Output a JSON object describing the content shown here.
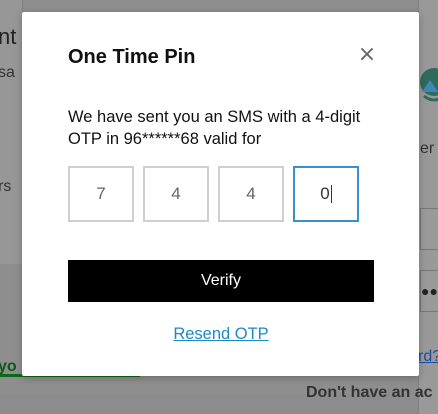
{
  "background": {
    "left_title_fragment": "nt",
    "left_text_fragment": "sa",
    "left_text_fragment_2": "rs",
    "left_link_fragment": "yo",
    "right_text_fragment": "er",
    "right_link_fragment": "rd?",
    "right_bottom_fragment": "Don't have an ac",
    "password_dots": "●●●"
  },
  "modal": {
    "title": "One Time Pin",
    "close_label": "×",
    "message": "We have sent you an SMS with a 4-digit OTP in 96******68 valid for",
    "otp_digits": [
      "7",
      "4",
      "4",
      "0"
    ],
    "verify_label": "Verify",
    "resend_label": "Resend OTP"
  },
  "colors": {
    "primary_button": "#000000",
    "link": "#1d89c7",
    "active_border": "#3a8fd0"
  }
}
